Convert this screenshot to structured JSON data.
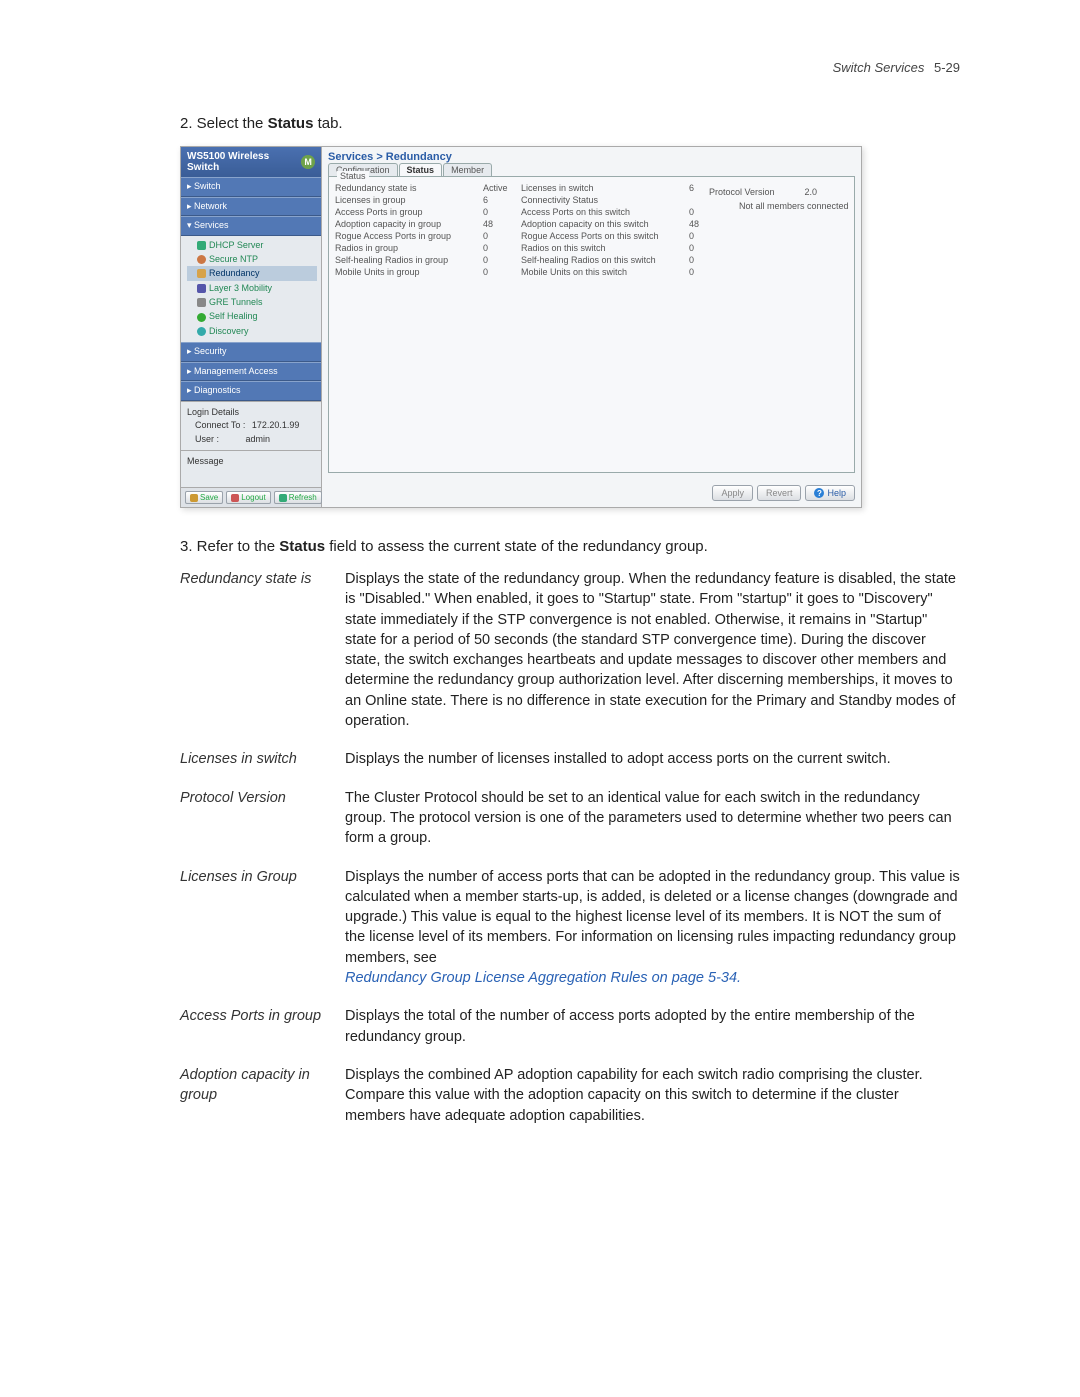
{
  "header": {
    "section": "Switch Services",
    "page": "5-29"
  },
  "step2": {
    "prefix": "2. Select the ",
    "bold": "Status",
    "suffix": " tab."
  },
  "step3": {
    "prefix": "3. Refer to the ",
    "bold": "Status",
    "suffix": " field to assess the current state of the redundancy group."
  },
  "screenshot": {
    "product_title": "WS5100 Wireless Switch",
    "logo_letter": "M",
    "nav_sections": {
      "switch": "▸ Switch",
      "network": "▸ Network",
      "services": "▾ Services",
      "security": "▸ Security",
      "mgmt": "▸ Management Access",
      "diag": "▸ Diagnostics"
    },
    "tree": {
      "dhcp": "DHCP Server",
      "ntp": "Secure NTP",
      "redundancy": "Redundancy",
      "l3": "Layer 3 Mobility",
      "gre": "GRE Tunnels",
      "selfheal": "Self Healing",
      "discovery": "Discovery"
    },
    "login": {
      "title": "Login Details",
      "connect_label": "Connect To :",
      "connect_value": "172.20.1.99",
      "user_label": "User :",
      "user_value": "admin",
      "message_label": "Message"
    },
    "bottom_buttons": {
      "save": "Save",
      "logout": "Logout",
      "refresh": "Refresh"
    },
    "breadcrumb": "Services > Redundancy",
    "tabs": {
      "config": "Configuration",
      "status": "Status",
      "member": "Member"
    },
    "panel_title": "Status",
    "status_rows": [
      {
        "l1": "Redundancy state is",
        "v1": "Active",
        "l2": "Licenses in switch",
        "v2": "6",
        "l3": "Protocol Version",
        "v3": "2.0"
      },
      {
        "l1": "Licenses in group",
        "v1": "6",
        "l2": "Connectivity Status",
        "v2": "",
        "l3": "",
        "v3": "Not all members connected"
      },
      {
        "l1": "Access Ports in group",
        "v1": "0",
        "l2": "Access Ports on this switch",
        "v2": "0"
      },
      {
        "l1": "Adoption capacity in group",
        "v1": "48",
        "l2": "Adoption capacity on this switch",
        "v2": "48"
      },
      {
        "l1": "Rogue Access Ports in group",
        "v1": "0",
        "l2": "Rogue Access Ports on this switch",
        "v2": "0"
      },
      {
        "l1": "Radios in group",
        "v1": "0",
        "l2": "Radios on this switch",
        "v2": "0"
      },
      {
        "l1": "Self-healing Radios in group",
        "v1": "0",
        "l2": "Self-healing Radios on this switch",
        "v2": "0"
      },
      {
        "l1": "Mobile Units in group",
        "v1": "0",
        "l2": "Mobile Units on this switch",
        "v2": "0"
      }
    ],
    "actions": {
      "apply": "Apply",
      "revert": "Revert",
      "help": "Help"
    }
  },
  "defs": [
    {
      "term": "Redundancy state is",
      "desc": "Displays the state of the redundancy group. When the redundancy feature is disabled, the state is \"Disabled.\" When enabled, it goes to \"Startup\" state. From \"startup\" it goes to \"Discovery\" state immediately if the STP convergence is not enabled. Otherwise, it remains in \"Startup\" state for a period of 50 seconds (the standard STP convergence time). During the discover state, the switch exchanges heartbeats and update messages to discover other members and determine the redundancy group authorization level. After discerning memberships, it moves to an Online state. There is no difference in state execution for the Primary and Standby modes of operation."
    },
    {
      "term": "Licenses in switch",
      "desc": "Displays the number of licenses installed to adopt access ports on the current switch."
    },
    {
      "term": "Protocol Version",
      "desc": "The Cluster Protocol should be set to an identical value for each switch in the redundancy group. The protocol version is one of the parameters used to determine whether two peers can form a group."
    },
    {
      "term": "Licenses in Group",
      "desc": "Displays the number of access ports that can be adopted in the redundancy group. This value is calculated when a member starts-up, is added, is deleted or a license changes (downgrade and upgrade.) This value is equal to the highest license level of its members. It is NOT the sum of the license level of its members. For information on licensing rules impacting redundancy group members, see",
      "link": "Redundancy Group License Aggregation Rules on page 5-34."
    },
    {
      "term": "Access Ports in group",
      "desc": "Displays the total of the number of access ports adopted by the entire membership of the redundancy group."
    },
    {
      "term": "Adoption capacity in group",
      "desc": "Displays the combined AP adoption capability for each switch radio comprising the cluster. Compare this value with the adoption capacity on this switch to determine if the cluster members have adequate adoption capabilities."
    }
  ]
}
